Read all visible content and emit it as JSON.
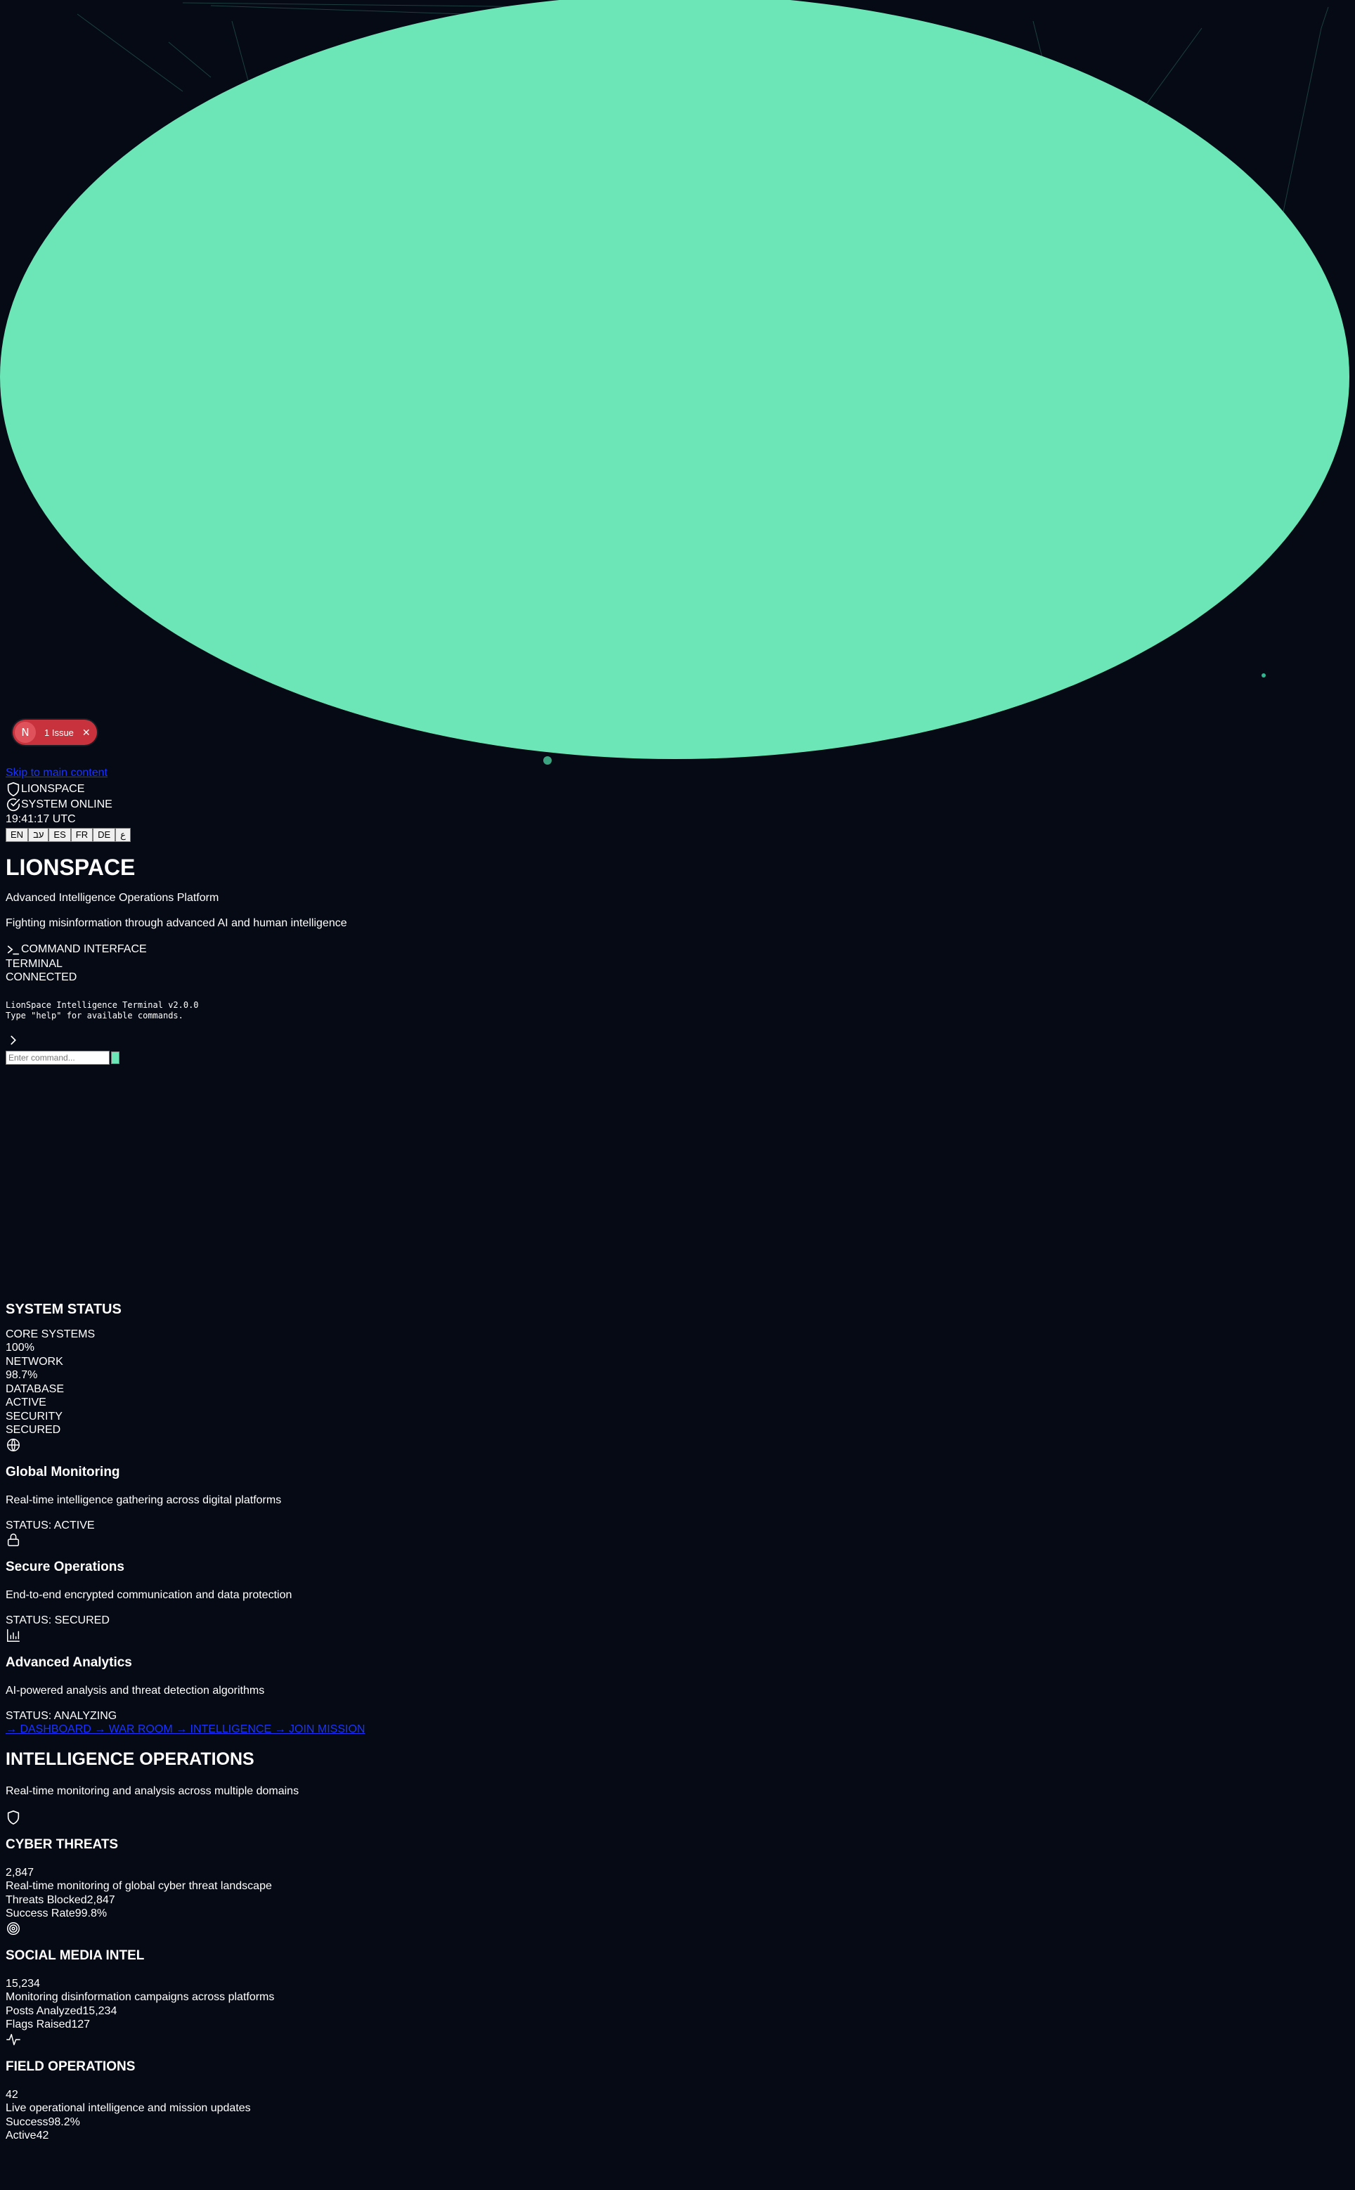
{
  "issue_badge": {
    "logo": "N",
    "label": "1 Issue",
    "close_icon": "close-icon"
  },
  "skip_link": "Skip to main content",
  "header": {
    "brand_icon": "shield-icon",
    "brand": "LIONSPACE",
    "status_icon": "check-circle-icon",
    "status": "SYSTEM ONLINE",
    "clock": "19:41:17 UTC",
    "languages": [
      "EN",
      "עב",
      "ES",
      "FR",
      "DE",
      "ع"
    ]
  },
  "hero": {
    "title": "LIONSPACE",
    "subtitle": "Advanced Intelligence Operations Platform",
    "tagline": "Fighting misinformation through advanced AI and human intelligence"
  },
  "terminal": {
    "icon": "terminal-icon",
    "title": "COMMAND INTERFACE",
    "label": "TERMINAL",
    "connection": "CONNECTED",
    "output_line1": "LionSpace Intelligence Terminal v2.0.0",
    "output_line2": "Type \"help\" for available commands.",
    "prompt_icon": "chevron-right-icon",
    "input_placeholder": "Enter command..."
  },
  "system_status": {
    "title": "SYSTEM STATUS",
    "items": [
      {
        "label": "CORE SYSTEMS",
        "value": "100%"
      },
      {
        "label": "NETWORK",
        "value": "98.7%"
      },
      {
        "label": "DATABASE",
        "value": "ACTIVE"
      },
      {
        "label": "SECURITY",
        "value": "SECURED"
      }
    ]
  },
  "features": [
    {
      "icon": "globe-icon",
      "title": "Global Monitoring",
      "desc": "Real-time intelligence gathering across digital platforms",
      "status": "STATUS: ACTIVE"
    },
    {
      "icon": "lock-icon",
      "title": "Secure Operations",
      "desc": "End-to-end encrypted communication and data protection",
      "status": "STATUS: SECURED"
    },
    {
      "icon": "bar-chart-icon",
      "title": "Advanced Analytics",
      "desc": "AI-powered analysis and threat detection algorithms",
      "status": "STATUS: ANALYZING"
    }
  ],
  "nav_links": "→ DASHBOARD → WAR ROOM → INTELLIGENCE → JOIN MISSION",
  "intel": {
    "title": "INTELLIGENCE OPERATIONS",
    "subtitle": "Real-time monitoring and analysis across multiple domains",
    "cards": [
      {
        "icon": "shield-icon",
        "title": "CYBER THREATS",
        "value": "2,847",
        "desc": "Real-time monitoring of global cyber threat landscape",
        "stat1": "Threats Blocked2,847",
        "stat2": "Success Rate99.8%"
      },
      {
        "icon": "target-icon",
        "title": "SOCIAL MEDIA INTEL",
        "value": "15,234",
        "desc": "Monitoring disinformation campaigns across platforms",
        "stat1": "Posts Analyzed15,234",
        "stat2": "Flags Raised127"
      },
      {
        "icon": "activity-icon",
        "title": "FIELD OPERATIONS",
        "value": "42",
        "desc": "Live operational intelligence and mission updates",
        "stat1": "Success98.2%",
        "stat2": "Active42"
      }
    ]
  },
  "colors": {
    "background": "#050a14",
    "accent": "#6ce6b6",
    "issue_red": "#c8323c",
    "link": "#1a33ff"
  }
}
